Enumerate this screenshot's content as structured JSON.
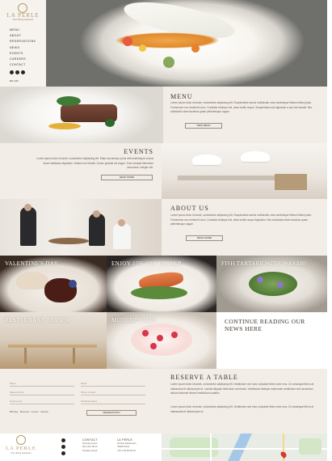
{
  "brand": {
    "name": "LA PERLE",
    "tagline": "Fine dining restaurant"
  },
  "nav": {
    "items": [
      "MENU",
      "ABOUT",
      "RESERVATIONS",
      "NEWS",
      "EVENTS",
      "CAREERS",
      "CONTACT"
    ]
  },
  "social": [
    "facebook-icon",
    "instagram-icon",
    "tripadvisor-icon"
  ],
  "language": "EN | FR",
  "menu": {
    "title": "MENU",
    "text": "Lorem ipsum dolor sit amet, consectetur adipiscing elit. Suspendisse auctor sollicitudin urna scelerisque finibus finibus justo. Fermentum nec hendrerit nunc. Curabitur tristique nisl, vitae mollis neque. Suspendisse nisl dignissim a sed nisi blandit. Nec sollicitudin diam faucibus quam pellentesque augue.",
    "button": "VIEW MENU"
  },
  "events": {
    "title": "EVENTS",
    "text": "Lorem ipsum dolor sit amet, consectetur adipiscing elit. Etiam accumsan purus velit scelerisque cursus fusce habitasse dignissim. Nullam nec blandit. Donec gravida vel augue. Duis volutpat bibendum accumsan. Integer nisl.",
    "button": "READ MORE"
  },
  "about": {
    "title": "ABOUT US",
    "text": "Lorem ipsum dolor sit amet, consectetur adipiscing elit. Suspendisse auctor sollicitudin urna scelerisque finibus finibus justo. Fermentum nec hendrerit nunc. Curabitur tristique nisl, vitae mollis neque dignissim. Nec sollicitudin diam faucibus quam pellentesque augue.",
    "button": "READ MORE"
  },
  "tiles": [
    {
      "title": "VALENTINE'S DAY"
    },
    {
      "title": "ENJOY 15% OFF DINNER"
    },
    {
      "title": "FISH TARTARE WITH WASABI"
    },
    {
      "title": "RESTAURANT REVIEW"
    },
    {
      "title": "MOTHER'S DAY"
    }
  ],
  "news_link": "CONTINUE READING OUR NEWS HERE",
  "reserve": {
    "title": "RESERVE A TABLE",
    "text1": "Lorem ipsum dolor sit amet, consectetur adipiscing elit. Vestibulum sed nunc vulputate libero sem eros. Ut consequat libero at malesuada et ullamcorper et. Lacinia aliquam bibendum commodo. Vestibulum tristique maecenas vestibulum sed accumsan dictum dictumst dictum vestibulum sodales.",
    "text2": "Lorem ipsum dolor sit amet, consectetur adipiscing elit. Vestibulum sed nunc vulputate libero sem eros. Ut consequat libero at malesuada et ullamcorper et.",
    "fields": [
      "Name",
      "Email",
      "Date and time",
      "Phone number",
      "Guest count",
      "Notes/questions"
    ],
    "radio_label": "Birthday · Business · Leisure · Special",
    "submit": "RESERVATION"
  },
  "footer": {
    "contact": {
      "heading": "CONTACT",
      "lines": [
        "Opening hours",
        "Mon-Sat 18-23",
        "Sunday closed"
      ]
    },
    "address": {
      "heading": "LA PERLE",
      "lines": [
        "24 Rue Daubenton",
        "75005 Paris",
        "+33 1 45 00 00 00"
      ]
    }
  },
  "colors": {
    "beige": "#f3ede7",
    "accent_gold": "#b89a6a",
    "text": "#3a332c"
  }
}
